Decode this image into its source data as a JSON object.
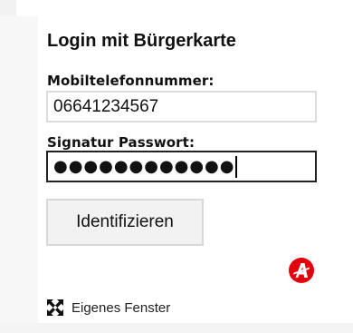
{
  "login": {
    "title": "Login mit Bürgerkarte",
    "phone_label": "Mobiltelefonnummer:",
    "phone_value": "06641234567",
    "password_label": "Signatur Passwort:",
    "password_masked": "●●●●●●●●●●●●",
    "submit_label": "Identifizieren",
    "fullscreen_label": "Eigenes Fenster",
    "logo_icon": "a-trust-logo-icon",
    "expand_icon": "expand-arrows-icon"
  },
  "colors": {
    "logo_red": "#e3000f",
    "focus_border": "#222222",
    "input_border": "#dcdcdc",
    "button_bg": "#f2f2f2"
  }
}
